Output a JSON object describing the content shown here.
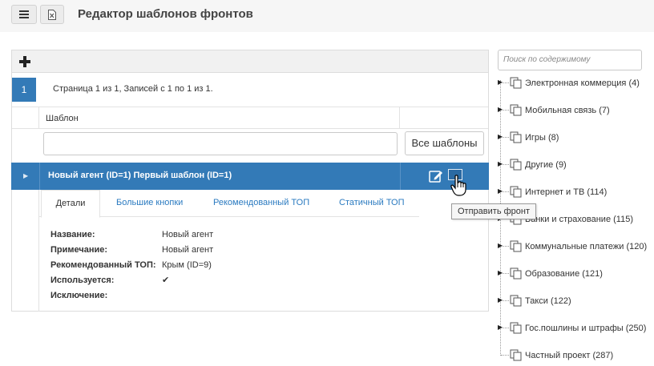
{
  "header": {
    "title": "Редактор шаблонов фронтов"
  },
  "pager": {
    "current_page": "1",
    "info": "Страница 1 из 1, Записей с 1 по 1 из 1."
  },
  "grid": {
    "column_header": "Шаблон",
    "filter_value": "",
    "all_templates_button": "Все шаблоны",
    "selected_row": {
      "text": "Новый агент (ID=1) Первый шаблон (ID=1)"
    }
  },
  "tabs": [
    {
      "label": "Детали",
      "active": true
    },
    {
      "label": "Большие кнопки",
      "active": false
    },
    {
      "label": "Рекомендованный ТОП",
      "active": false
    },
    {
      "label": "Статичный ТОП",
      "active": false
    }
  ],
  "details": {
    "rows": [
      {
        "key": "Название:",
        "value": "Новый агент"
      },
      {
        "key": "Примечание:",
        "value": "Новый агент"
      },
      {
        "key": "Рекомендованный ТОП:",
        "value": "Крым (ID=9)"
      },
      {
        "key": "Используется:",
        "value": "✔"
      },
      {
        "key": "Исключение:",
        "value": ""
      }
    ]
  },
  "tooltip": {
    "text": "Отправить фронт"
  },
  "sidebar": {
    "search_placeholder": "Поиск по содержимому",
    "items": [
      {
        "label": "Электронная коммерция (4)"
      },
      {
        "label": "Мобильная связь (7)"
      },
      {
        "label": "Игры (8)"
      },
      {
        "label": "Другие (9)"
      },
      {
        "label": "Интернет и ТВ (114)"
      },
      {
        "label": "Банки и страхование (115)"
      },
      {
        "label": "Коммунальные платежи (120)"
      },
      {
        "label": "Образование (121)"
      },
      {
        "label": "Такси (122)"
      },
      {
        "label": "Гос.пошлины и штрафы (250)"
      },
      {
        "label": "Частный проект (287)"
      }
    ]
  },
  "colors": {
    "accent": "#337ab7",
    "link": "#2a7ac0"
  },
  "icons": {
    "menu": "hamburger-icon",
    "excel": "excel-file-icon",
    "add": "plus-icon",
    "edit": "edit-pencil-icon",
    "send": "send-front-icon",
    "tree_doc": "copy-documents-icon"
  }
}
